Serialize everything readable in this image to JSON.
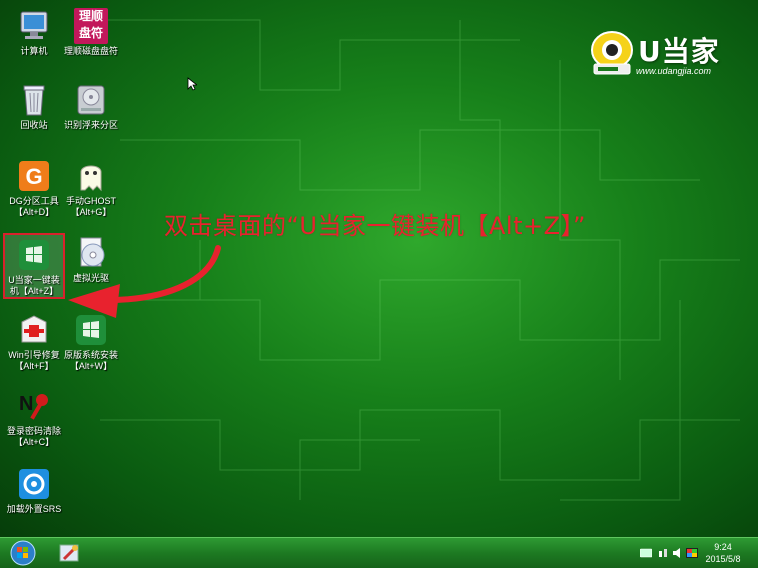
{
  "brand": {
    "name": "U当家",
    "url": "www.udangjia.com"
  },
  "instruction": "双击桌面的“U当家一键装机【Alt+Z】”",
  "desktop_icons": [
    {
      "label": "计算机",
      "icon": "computer-icon"
    },
    {
      "label": "理顺磁盘盘符",
      "icon": "disk-order-icon",
      "badge_line1": "理顺",
      "badge_line2": "盘符"
    },
    {
      "label": "回收站",
      "icon": "recycle-bin-icon"
    },
    {
      "label": "识别浮来分区",
      "icon": "hard-drive-icon"
    },
    {
      "label": "DG分区工具",
      "sublabel": "【Alt+D】",
      "icon": "diskgenius-icon"
    },
    {
      "label": "手动GHOST",
      "sublabel": "【Alt+G】",
      "icon": "ghost-icon"
    },
    {
      "label": "U当家一键装",
      "sublabel": "机【Alt+Z】",
      "icon": "udangjia-install-icon"
    },
    {
      "label": "虚拟光驱",
      "icon": "virtual-drive-icon"
    },
    {
      "label": "Win引导修复",
      "sublabel": "【Alt+F】",
      "icon": "boot-repair-icon"
    },
    {
      "label": "原版系统安装",
      "sublabel": "【Alt+W】",
      "icon": "windows-install-icon"
    },
    {
      "label": "登录密码清除",
      "sublabel": "【Alt+C】",
      "icon": "password-clear-icon"
    },
    {
      "label": "加载外置SRS",
      "icon": "srs-load-icon"
    }
  ],
  "taskbar": {
    "time": "9:24",
    "date": "2015/5/8",
    "start_icon": "windows-start-icon",
    "tray_icons": [
      "keyboard-icon",
      "network-icon",
      "volume-icon",
      "action-center-icon"
    ]
  },
  "colors": {
    "desktop_green": "#17801a",
    "instruction_red": "#e8222e",
    "taskbar_green": "#1d7a22"
  }
}
